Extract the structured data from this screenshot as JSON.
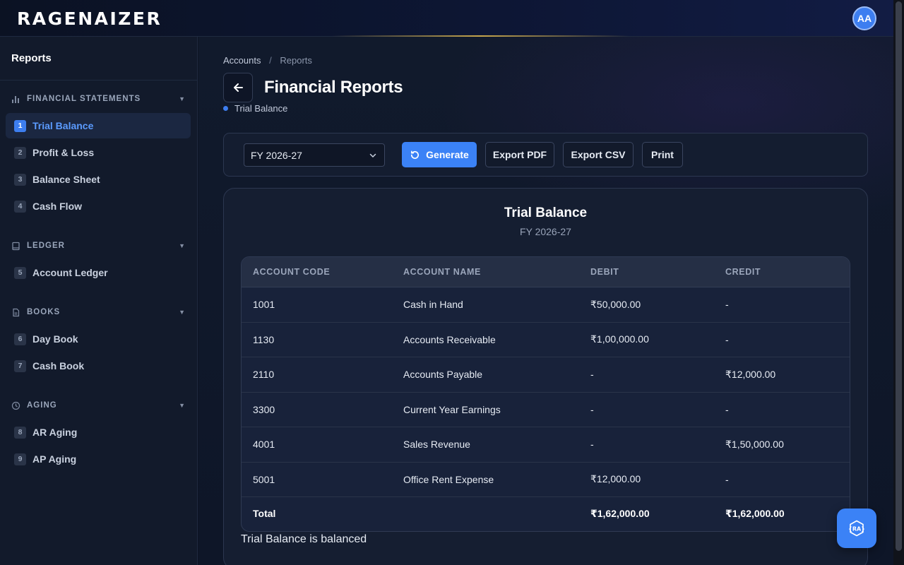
{
  "app": {
    "logo_text": "RAGENAIZER",
    "avatar_initials": "AA"
  },
  "sidebar": {
    "title": "Reports",
    "groups": [
      {
        "name": "FINANCIAL STATEMENTS",
        "icon": "bar-chart-icon",
        "items": [
          {
            "num": "1",
            "label": "Trial Balance",
            "active": true
          },
          {
            "num": "2",
            "label": "Profit & Loss"
          },
          {
            "num": "3",
            "label": "Balance Sheet"
          },
          {
            "num": "4",
            "label": "Cash Flow"
          }
        ]
      },
      {
        "name": "LEDGER",
        "icon": "book-icon",
        "items": [
          {
            "num": "5",
            "label": "Account Ledger"
          }
        ]
      },
      {
        "name": "BOOKS",
        "icon": "document-icon",
        "items": [
          {
            "num": "6",
            "label": "Day Book"
          },
          {
            "num": "7",
            "label": "Cash Book"
          }
        ]
      },
      {
        "name": "AGING",
        "icon": "clock-icon",
        "items": [
          {
            "num": "8",
            "label": "AR Aging"
          },
          {
            "num": "9",
            "label": "AP Aging"
          }
        ]
      }
    ]
  },
  "main": {
    "breadcrumb": {
      "parent": "Accounts",
      "separator": "/",
      "current": "Reports"
    },
    "page_title": "Financial Reports",
    "subtitle": "Trial Balance",
    "toolbar": {
      "fiscal_year": "FY 2026-27",
      "generate": "Generate",
      "export_pdf": "Export PDF",
      "export_csv": "Export CSV",
      "print": "Print"
    },
    "report": {
      "title": "Trial Balance",
      "period": "FY 2026-27",
      "columns": [
        "ACCOUNT CODE",
        "ACCOUNT NAME",
        "DEBIT",
        "CREDIT"
      ],
      "rows": [
        [
          "1001",
          "Cash in Hand",
          "₹50,000.00",
          "-"
        ],
        [
          "1130",
          "Accounts Receivable",
          "₹1,00,000.00",
          "-"
        ],
        [
          "2110",
          "Accounts Payable",
          "-",
          "₹12,000.00"
        ],
        [
          "3300",
          "Current Year Earnings",
          "-",
          "-"
        ],
        [
          "4001",
          "Sales Revenue",
          "-",
          "₹1,50,000.00"
        ],
        [
          "5001",
          "Office Rent Expense",
          "₹12,000.00",
          "-"
        ]
      ],
      "total": {
        "label": "Total",
        "debit": "₹1,62,000.00",
        "credit": "₹1,62,000.00"
      },
      "status": "Trial Balance is balanced"
    }
  },
  "fab": {
    "icon": "assistant-icon",
    "label": "{RA}"
  },
  "colors": {
    "accent": "#3b82f6",
    "background": "#0d1424",
    "surface": "#151e31"
  }
}
